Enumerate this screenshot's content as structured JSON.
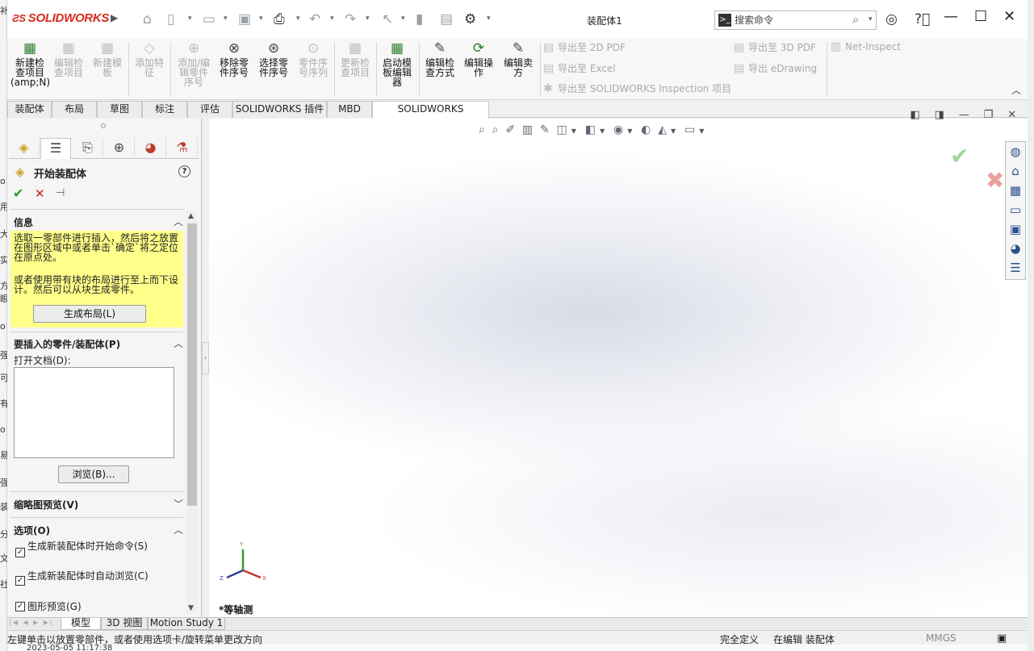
{
  "app": {
    "logo": "SOLIDWORKS",
    "doc_title": "装配体1"
  },
  "search": {
    "placeholder": "搜索命令"
  },
  "command_manager": {
    "buttons": [
      {
        "label": "新建检\n查项目\n(amp;N)",
        "icon": "new-inspection-icon",
        "enabled": true
      },
      {
        "label": "编辑检\n查项目",
        "icon": "edit-inspection-icon",
        "enabled": false
      },
      {
        "label": "新建模\n板",
        "icon": "new-template-icon",
        "enabled": false
      },
      {
        "label": "添加特\n征",
        "icon": "add-feature-icon",
        "enabled": false
      },
      {
        "label": "添加/编\n辑零件\n序号",
        "icon": "add-balloon-icon",
        "enabled": false
      },
      {
        "label": "移除零\n件序号",
        "icon": "remove-balloon-icon",
        "enabled": true
      },
      {
        "label": "选择零\n件序号",
        "icon": "select-balloon-icon",
        "enabled": true
      },
      {
        "label": "零件序\n号序列",
        "icon": "balloon-sequence-icon",
        "enabled": false
      },
      {
        "label": "更新检\n查项目",
        "icon": "update-inspection-icon",
        "enabled": false
      },
      {
        "label": "启动模\n板编辑\n器",
        "icon": "template-editor-icon",
        "enabled": true
      },
      {
        "label": "编辑检\n查方式",
        "icon": "edit-method-icon",
        "enabled": true
      },
      {
        "label": "编辑操\n作",
        "icon": "edit-operation-icon",
        "enabled": true
      },
      {
        "label": "编辑卖\n方",
        "icon": "edit-vendor-icon",
        "enabled": true
      }
    ],
    "exports": {
      "pdf2d": "导出至 2D PDF",
      "excel": "导出至 Excel",
      "sw_inspection": "导出至 SOLIDWORKS Inspection 项目",
      "pdf3d": "导出至 3D PDF",
      "edrawing": "导出 eDrawing",
      "net_inspect": "Net-Inspect"
    }
  },
  "tabs": [
    "装配体",
    "布局",
    "草图",
    "标注",
    "评估",
    "SOLIDWORKS 插件",
    "MBD",
    "SOLIDWORKS Inspection"
  ],
  "active_tab_index": 7,
  "property_manager": {
    "title": "开始装配体",
    "info": {
      "header": "信息",
      "text1": "选取一零部件进行插入，然后将之放置在图形区域中或者单击`确定`将之定位在原点处。",
      "text2": "或者使用带有块的布局进行至上而下设计。然后可以从块生成零件。",
      "button": "生成布局(L)"
    },
    "insert": {
      "header": "要插入的零件/装配体(P)",
      "open_doc_label": "打开文档(D):",
      "browse": "浏览(B)..."
    },
    "thumbnail": {
      "header": "缩略图预览(V)"
    },
    "options": {
      "header": "选项(O)",
      "items": [
        {
          "label": "生成新装配体时开始命令(S)",
          "checked": true
        },
        {
          "label": "生成新装配体时自动浏览(C)",
          "checked": true
        },
        {
          "label": "图形预览(G)",
          "checked": true
        }
      ]
    }
  },
  "graphics": {
    "view_name": "*等轴测",
    "triad": {
      "x": "X",
      "y": "Y",
      "z": "Z"
    }
  },
  "bottom_tabs": [
    "模型",
    "3D 视图",
    "Motion Study 1"
  ],
  "status": {
    "message": "左键单击以放置零部件，或者使用选项卡/旋转菜单更改方向",
    "definition": "完全定义",
    "editing": "在编辑 装配体",
    "units": "MMGS"
  },
  "under_text": "2023-05-05 11:17:38"
}
